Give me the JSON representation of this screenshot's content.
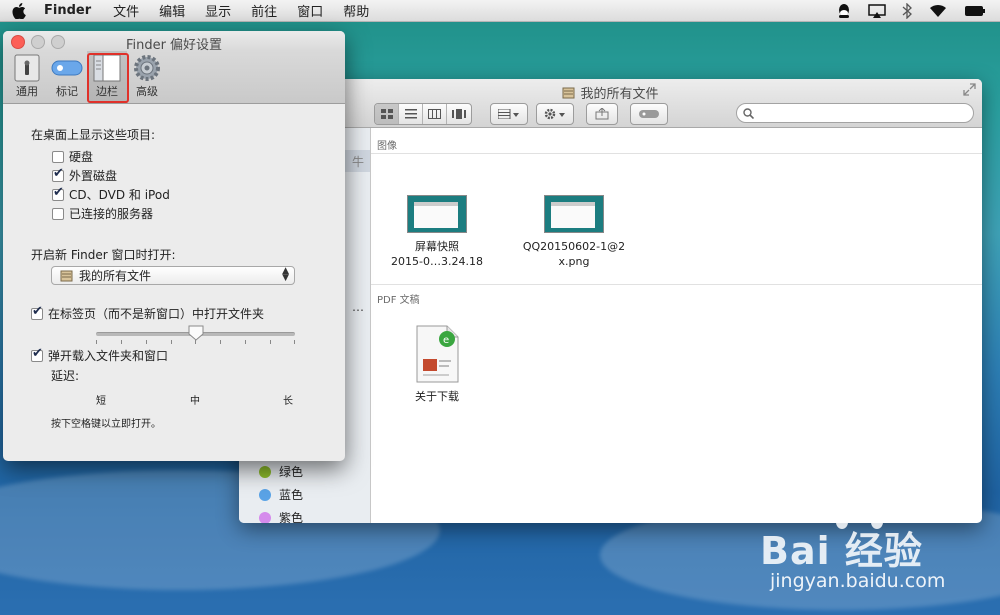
{
  "menubar": {
    "app_name": "Finder",
    "items": [
      "文件",
      "编辑",
      "显示",
      "前往",
      "窗口",
      "帮助"
    ]
  },
  "finder_window": {
    "title": "我的所有文件",
    "search_placeholder": "",
    "sections": [
      {
        "header": "图像",
        "files": [
          {
            "name_line1": "屏幕快照",
            "name_line2": "2015-0…3.24.18"
          },
          {
            "name_line1": "QQ20150602-1@2",
            "name_line2": "x.png"
          }
        ]
      },
      {
        "header": "PDF 文稿",
        "files": [
          {
            "name_line1": "关于下载",
            "name_line2": ""
          }
        ]
      }
    ],
    "sidebar_tags": [
      {
        "label": "绿色",
        "color": "#8dbb2c"
      },
      {
        "label": "蓝色",
        "color": "#5aa3e6"
      },
      {
        "label": "紫色",
        "color": "#d58bec"
      }
    ],
    "sidebar_partial_1": "牛",
    "sidebar_partial_2": "…"
  },
  "prefs": {
    "title": "Finder 偏好设置",
    "tabs": [
      {
        "label": "通用",
        "icon": "general-icon"
      },
      {
        "label": "标记",
        "icon": "tags-icon"
      },
      {
        "label": "边栏",
        "icon": "sidebar-icon"
      },
      {
        "label": "高级",
        "icon": "gear-icon"
      }
    ],
    "selected_tab": "边栏",
    "desktop_heading": "在桌面上显示这些项目:",
    "desktop_items": [
      {
        "label": "硬盘",
        "checked": false
      },
      {
        "label": "外置磁盘",
        "checked": true
      },
      {
        "label": "CD、DVD 和 iPod",
        "checked": true
      },
      {
        "label": "已连接的服务器",
        "checked": false
      }
    ],
    "new_window_heading": "开启新 Finder 窗口时打开:",
    "new_window_value": "我的所有文件",
    "open_in_tabs_label": "在标签页（而不是新窗口）中打开文件夹",
    "open_in_tabs_checked": true,
    "spring_load_label": "弹开载入文件夹和窗口",
    "spring_load_checked": true,
    "delay_label": "延迟:",
    "slider_labels": [
      "短",
      "中",
      "长"
    ],
    "slider_value": 0.5,
    "hint": "按下空格键以立即打开。"
  },
  "watermark": {
    "brand": "Bai 经验",
    "url": "jingyan.baidu.com"
  }
}
